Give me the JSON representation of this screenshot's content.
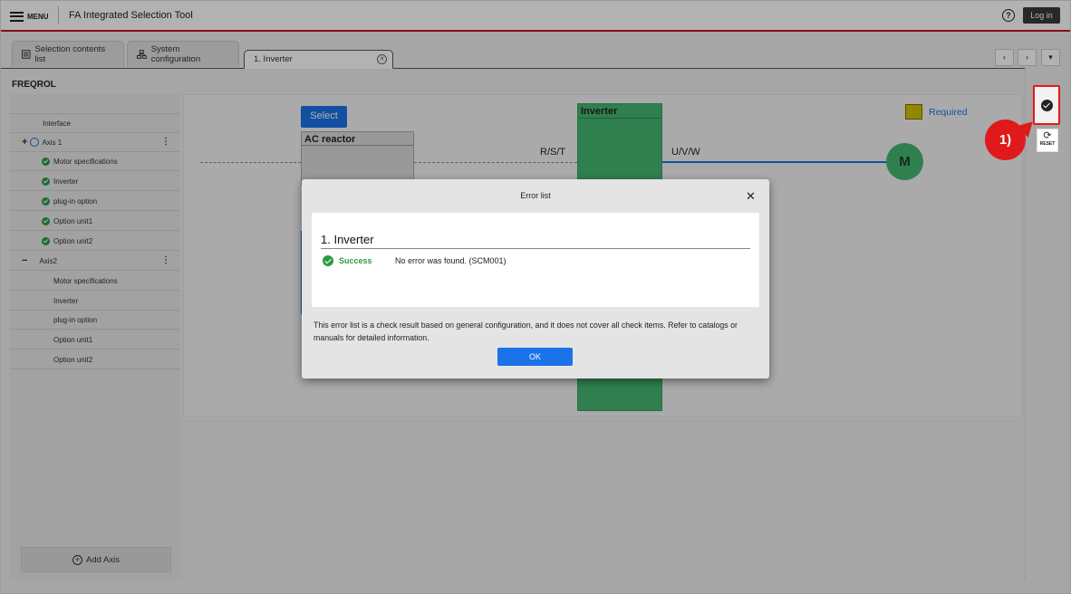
{
  "header": {
    "menu_label": "MENU",
    "app_title": "FA Integrated Selection Tool",
    "help_glyph": "?",
    "login_label": "Log in"
  },
  "tabs": [
    {
      "label": "Selection contents list",
      "icon": "list-icon"
    },
    {
      "label": "System configuration",
      "icon": "network-icon"
    },
    {
      "label": "1. Inverter",
      "icon": "close-icon"
    }
  ],
  "tab_nav": {
    "prev": "‹",
    "next": "›",
    "more": "▾"
  },
  "section_title": "FREQROL",
  "sidebar": {
    "rows": [
      {
        "label": "Interface"
      },
      {
        "label": "Axis 1",
        "prefix": "+",
        "more": "⋮"
      },
      {
        "label": "Motor specifications"
      },
      {
        "label": "Inverter"
      },
      {
        "label": "plug-in option"
      },
      {
        "label": "Option unit1"
      },
      {
        "label": "Option unit2"
      },
      {
        "label": "Axis2",
        "prefix": "−",
        "more": "⋮"
      },
      {
        "label": "Motor specifications"
      },
      {
        "label": "Inverter"
      },
      {
        "label": "plug-in option"
      },
      {
        "label": "Option unit1"
      },
      {
        "label": "Option unit2"
      }
    ],
    "add_axis_label": "Add Axis"
  },
  "diagram": {
    "select_label": "Select",
    "ac_reactor_label": "AC reactor",
    "inverter_label": "Inverter",
    "rst_label": "R/S/T",
    "uvw_label": "U/V/W",
    "motor_label": "M",
    "legend_label": "Required",
    "legend_color": "#d4c200",
    "accent_color": "#1a73e8",
    "inverter_color": "#45b772"
  },
  "tools": {
    "reset_label": "RESET",
    "callout_label": "1)"
  },
  "dialog": {
    "title": "Error list",
    "close_glyph": "✕",
    "heading": "1. Inverter",
    "status": "Success",
    "message": "No error was found. (SCM001)",
    "note": "This error list is a check result based on general configuration, and it does not cover all check items. Refer to catalogs or manuals for detailed information.",
    "ok_label": "OK"
  }
}
